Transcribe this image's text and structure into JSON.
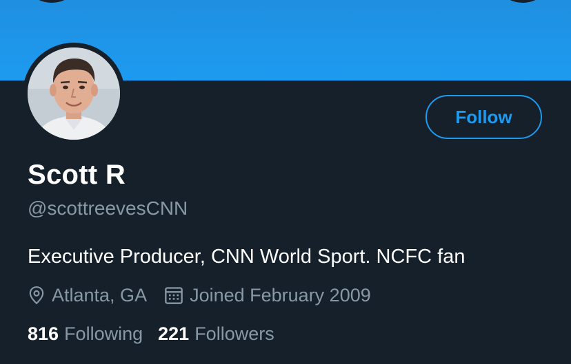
{
  "profile": {
    "name": "Scott R",
    "handle": "@scottreevesCNN",
    "bio": "Executive Producer, CNN World Sport. NCFC fan",
    "location": "Atlanta, GA",
    "joined": "Joined February 2009",
    "following_count": "816",
    "following_label": "Following",
    "followers_count": "221",
    "followers_label": "Followers"
  },
  "actions": {
    "follow_label": "Follow"
  },
  "icons": {
    "location": "location-pin-icon",
    "calendar": "calendar-icon"
  },
  "colors": {
    "background": "#15202b",
    "banner": "#1d9bf0",
    "accent": "#1d9bf0",
    "secondary_text": "#8899a6"
  }
}
